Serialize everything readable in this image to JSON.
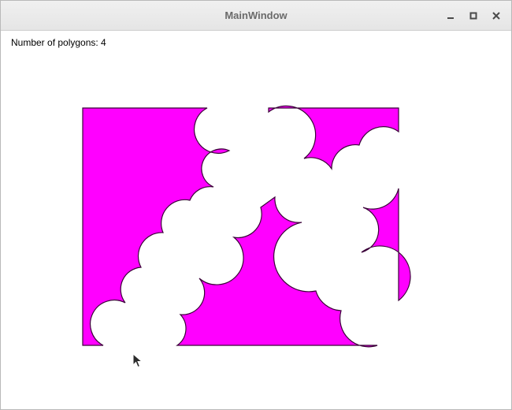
{
  "window": {
    "title": "MainWindow",
    "controls": [
      "minimize-icon",
      "maximize-icon",
      "close-icon"
    ]
  },
  "status": {
    "text": "Number of polygons: 4"
  },
  "canvas": {
    "polygon_fill": "#ff00ff",
    "polygon_stroke": "#3a0038",
    "background": "#ffffff"
  }
}
